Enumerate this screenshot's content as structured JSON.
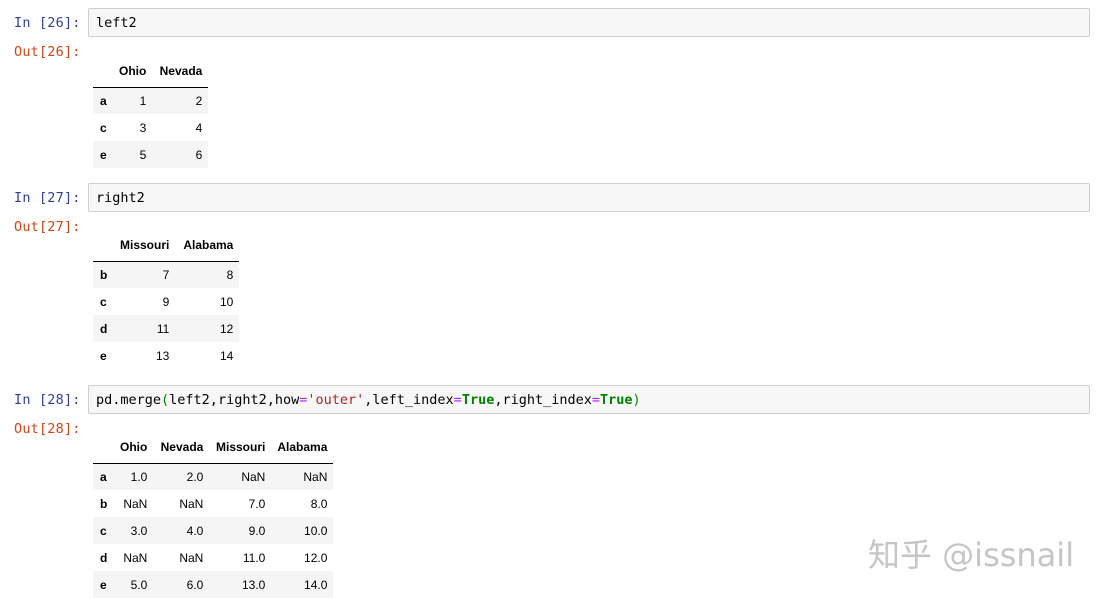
{
  "cells": [
    {
      "in_prompt": "In [26]:",
      "code": "left2",
      "out_prompt": "Out[26]:",
      "table": {
        "columns": [
          "Ohio",
          "Nevada"
        ],
        "rows": [
          {
            "index": "a",
            "values": [
              "1",
              "2"
            ]
          },
          {
            "index": "c",
            "values": [
              "3",
              "4"
            ]
          },
          {
            "index": "e",
            "values": [
              "5",
              "6"
            ]
          }
        ]
      }
    },
    {
      "in_prompt": "In [27]:",
      "code": "right2",
      "out_prompt": "Out[27]:",
      "table": {
        "columns": [
          "Missouri",
          "Alabama"
        ],
        "rows": [
          {
            "index": "b",
            "values": [
              "7",
              "8"
            ]
          },
          {
            "index": "c",
            "values": [
              "9",
              "10"
            ]
          },
          {
            "index": "d",
            "values": [
              "11",
              "12"
            ]
          },
          {
            "index": "e",
            "values": [
              "13",
              "14"
            ]
          }
        ]
      }
    },
    {
      "in_prompt": "In [28]:",
      "code_tokens": {
        "t1": "pd.merge",
        "t2": "(",
        "t3": "left2,right2,how",
        "t4": "=",
        "t5": "'outer'",
        "t6": ",left_index",
        "t7": "=",
        "t8": "True",
        "t9": ",right_index",
        "t10": "=",
        "t11": "True",
        "t12": ")"
      },
      "out_prompt": "Out[28]:",
      "table": {
        "columns": [
          "Ohio",
          "Nevada",
          "Missouri",
          "Alabama"
        ],
        "rows": [
          {
            "index": "a",
            "values": [
              "1.0",
              "2.0",
              "NaN",
              "NaN"
            ]
          },
          {
            "index": "b",
            "values": [
              "NaN",
              "NaN",
              "7.0",
              "8.0"
            ]
          },
          {
            "index": "c",
            "values": [
              "3.0",
              "4.0",
              "9.0",
              "10.0"
            ]
          },
          {
            "index": "d",
            "values": [
              "NaN",
              "NaN",
              "11.0",
              "12.0"
            ]
          },
          {
            "index": "e",
            "values": [
              "5.0",
              "6.0",
              "13.0",
              "14.0"
            ]
          }
        ]
      }
    }
  ],
  "watermark": "知乎 @issnail"
}
